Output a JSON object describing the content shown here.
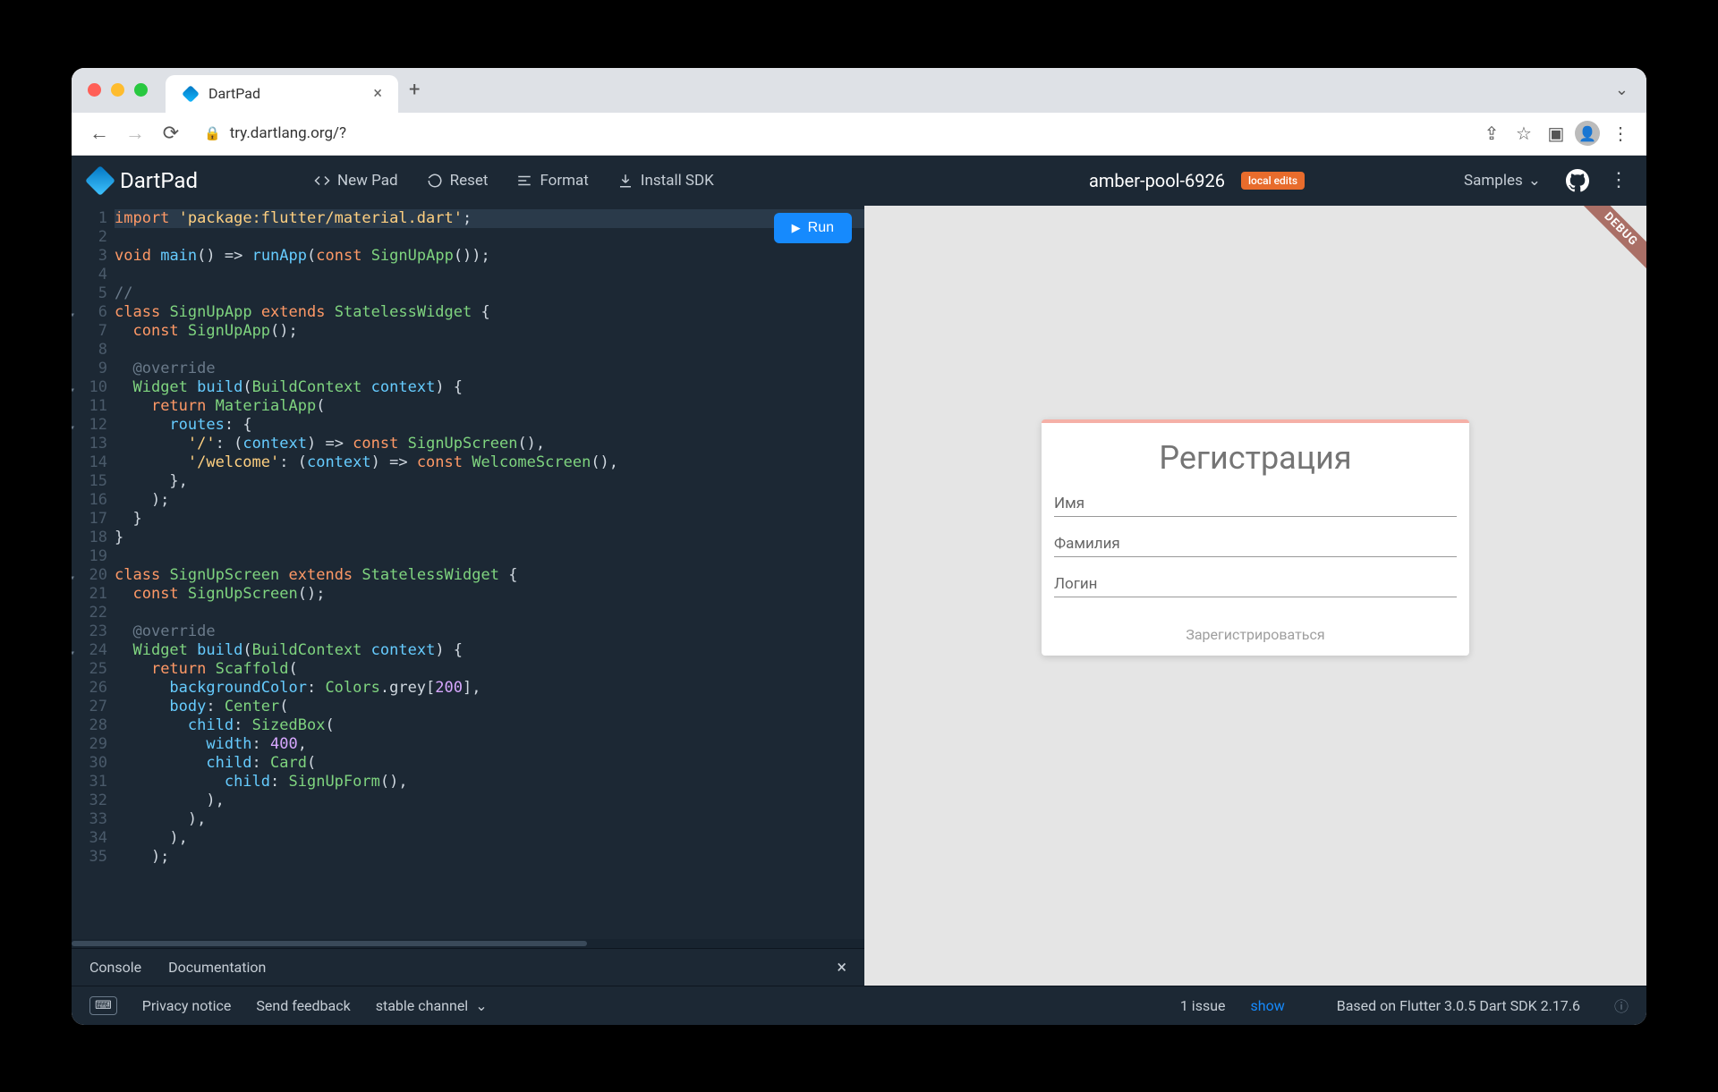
{
  "browser": {
    "tab_title": "DartPad",
    "url": "try.dartlang.org/?",
    "traffic": {
      "red": "#ff5f57",
      "yellow": "#febc2e",
      "green": "#28c840"
    }
  },
  "header": {
    "logo": "DartPad",
    "new_pad": "New Pad",
    "reset": "Reset",
    "format": "Format",
    "install_sdk": "Install SDK",
    "pad_name": "amber-pool-6926",
    "local_edits": "local edits",
    "samples": "Samples"
  },
  "run_label": "Run",
  "code_lines": [
    {
      "n": "1",
      "fold": "",
      "html": "<span class='k1'>import</span> <span class='k4'>'package:flutter/material.dart'</span>;"
    },
    {
      "n": "2",
      "fold": "",
      "html": ""
    },
    {
      "n": "3",
      "fold": "",
      "html": "<span class='k1'>void</span> <span class='k2'>main</span>() =&gt; <span class='k2'>runApp</span>(<span class='k1'>const</span> <span class='k3'>SignUpApp</span>());"
    },
    {
      "n": "4",
      "fold": "",
      "html": ""
    },
    {
      "n": "5",
      "fold": "",
      "html": "<span class='k5'>//</span>"
    },
    {
      "n": "6",
      "fold": "▾",
      "html": "<span class='k1'>class</span> <span class='k3'>SignUpApp</span> <span class='k1'>extends</span> <span class='k3'>StatelessWidget</span> {"
    },
    {
      "n": "7",
      "fold": "",
      "html": "  <span class='k1'>const</span> <span class='k3'>SignUpApp</span>();"
    },
    {
      "n": "8",
      "fold": "",
      "html": ""
    },
    {
      "n": "9",
      "fold": "",
      "html": "  <span class='k5'>@override</span>"
    },
    {
      "n": "10",
      "fold": "▾",
      "html": "  <span class='k3'>Widget</span> <span class='k2'>build</span>(<span class='k3'>BuildContext</span> <span class='k2'>context</span>) {"
    },
    {
      "n": "11",
      "fold": "",
      "html": "    <span class='k1'>return</span> <span class='k3'>MaterialApp</span>("
    },
    {
      "n": "12",
      "fold": "▾",
      "html": "      <span class='k2'>routes</span>: {"
    },
    {
      "n": "13",
      "fold": "",
      "html": "        <span class='k4'>'/'</span>: (<span class='k2'>context</span>) =&gt; <span class='k1'>const</span> <span class='k3'>SignUpScreen</span>(),"
    },
    {
      "n": "14",
      "fold": "",
      "html": "        <span class='k4'>'/welcome'</span>: (<span class='k2'>context</span>) =&gt; <span class='k1'>const</span> <span class='k3'>WelcomeScreen</span>(),"
    },
    {
      "n": "15",
      "fold": "",
      "html": "      },"
    },
    {
      "n": "16",
      "fold": "",
      "html": "    );"
    },
    {
      "n": "17",
      "fold": "",
      "html": "  }"
    },
    {
      "n": "18",
      "fold": "",
      "html": "}"
    },
    {
      "n": "19",
      "fold": "",
      "html": ""
    },
    {
      "n": "20",
      "fold": "▾",
      "html": "<span class='k1'>class</span> <span class='k3'>SignUpScreen</span> <span class='k1'>extends</span> <span class='k3'>StatelessWidget</span> {"
    },
    {
      "n": "21",
      "fold": "",
      "html": "  <span class='k1'>const</span> <span class='k3'>SignUpScreen</span>();"
    },
    {
      "n": "22",
      "fold": "",
      "html": ""
    },
    {
      "n": "23",
      "fold": "",
      "html": "  <span class='k5'>@override</span>"
    },
    {
      "n": "24",
      "fold": "▾",
      "html": "  <span class='k3'>Widget</span> <span class='k2'>build</span>(<span class='k3'>BuildContext</span> <span class='k2'>context</span>) {"
    },
    {
      "n": "25",
      "fold": "",
      "html": "    <span class='k1'>return</span> <span class='k3'>Scaffold</span>("
    },
    {
      "n": "26",
      "fold": "",
      "html": "      <span class='k2'>backgroundColor</span>: <span class='k3'>Colors</span>.grey[<span class='k6'>200</span>],"
    },
    {
      "n": "27",
      "fold": "",
      "html": "      <span class='k2'>body</span>: <span class='k3'>Center</span>("
    },
    {
      "n": "28",
      "fold": "",
      "html": "        <span class='k2'>child</span>: <span class='k3'>SizedBox</span>("
    },
    {
      "n": "29",
      "fold": "",
      "html": "          <span class='k2'>width</span>: <span class='k6'>400</span>,"
    },
    {
      "n": "30",
      "fold": "",
      "html": "          <span class='k2'>child</span>: <span class='k3'>Card</span>("
    },
    {
      "n": "31",
      "fold": "",
      "html": "            <span class='k2'>child</span>: <span class='k3'>SignUpForm</span>(),"
    },
    {
      "n": "32",
      "fold": "",
      "html": "          ),"
    },
    {
      "n": "33",
      "fold": "",
      "html": "        ),"
    },
    {
      "n": "34",
      "fold": "",
      "html": "      ),"
    },
    {
      "n": "35",
      "fold": "",
      "html": "    );"
    }
  ],
  "preview": {
    "debug_banner": "DEBUG",
    "card_title": "Регистрация",
    "field_first_name": "Имя",
    "field_last_name": "Фамилия",
    "field_login": "Логин",
    "submit": "Зарегистрироваться"
  },
  "console": {
    "tab_console": "Console",
    "tab_docs": "Documentation"
  },
  "footer": {
    "privacy": "Privacy notice",
    "feedback": "Send feedback",
    "channel": "stable channel",
    "issue_count": "1 issue",
    "show": "show",
    "sdk": "Based on Flutter 3.0.5 Dart SDK 2.17.6"
  }
}
